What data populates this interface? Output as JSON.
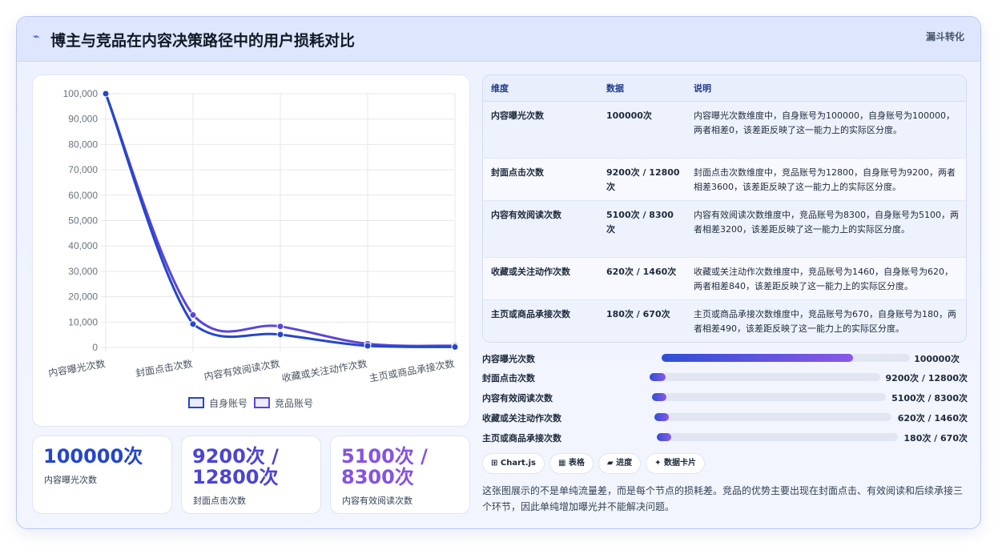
{
  "header": {
    "icon": "trend-icon",
    "title": "博主与竞品在内容决策路径中的用户损耗对比",
    "tag": "漏斗转化"
  },
  "chart_data": {
    "type": "line",
    "categories": [
      "内容曝光次数",
      "封面点击次数",
      "内容有效阅读次数",
      "收藏或关注动作次数",
      "主页或商品承接次数"
    ],
    "series": [
      {
        "name": "自身账号",
        "values": [
          100000,
          9200,
          5100,
          620,
          180
        ],
        "color": "#2446c9"
      },
      {
        "name": "竞品账号",
        "values": [
          100000,
          12800,
          8300,
          1460,
          670
        ],
        "color": "#5b45d6"
      }
    ],
    "ylim": [
      0,
      100000
    ],
    "yticks": [
      "0",
      "10,000",
      "20,000",
      "30,000",
      "40,000",
      "50,000",
      "60,000",
      "70,000",
      "80,000",
      "90,000",
      "100,000"
    ],
    "grid": true,
    "legend": "bottom"
  },
  "kpis": [
    {
      "value": "100000次",
      "label": "内容曝光次数",
      "color": "#2446c9"
    },
    {
      "value": "9200次 / 12800次",
      "label": "封面点击次数",
      "color": "#4a45d2"
    },
    {
      "value": "5100次 / 8300次",
      "label": "内容有效阅读次数",
      "color": "#8553e2"
    }
  ],
  "table": {
    "headers": [
      "维度",
      "数据",
      "说明"
    ],
    "rows": [
      {
        "dim": "内容曝光次数",
        "data": "100000次",
        "desc": "内容曝光次数维度中，自身账号为100000，自身账号为100000，两者相差0，该差距反映了这一能力上的实际区分度。"
      },
      {
        "dim": "封面点击次数",
        "data": "9200次 / 12800次",
        "desc": "封面点击次数维度中，竞品账号为12800，自身账号为9200，两者相差3600，该差距反映了这一能力上的实际区分度。"
      },
      {
        "dim": "内容有效阅读次数",
        "data": "5100次 / 8300次",
        "desc": "内容有效阅读次数维度中，竞品账号为8300，自身账号为5100，两者相差3200，该差距反映了这一能力上的实际区分度。"
      },
      {
        "dim": "收藏或关注动作次数",
        "data": "620次 / 1460次",
        "desc": "收藏或关注动作次数维度中，竞品账号为1460，自身账号为620，两者相差840，该差距反映了这一能力上的实际区分度。"
      },
      {
        "dim": "主页或商品承接次数",
        "data": "180次 / 670次",
        "desc": "主页或商品承接次数维度中，竞品账号为670，自身账号为180，两者相差490，该差距反映了这一能力上的实际区分度。"
      }
    ]
  },
  "progress": [
    {
      "label": "内容曝光次数",
      "value": "100000次",
      "fraction": 0.77
    },
    {
      "label": "封面点击次数",
      "value": "9200次 / 12800次",
      "fraction": 0.07
    },
    {
      "label": "内容有效阅读次数",
      "value": "5100次 / 8300次",
      "fraction": 0.06
    },
    {
      "label": "收藏或关注动作次数",
      "value": "620次 / 1460次",
      "fraction": 0.06
    },
    {
      "label": "主页或商品承接次数",
      "value": "180次 / 670次",
      "fraction": 0.06
    }
  ],
  "chips": [
    "⊞ Chart.js",
    "▦ 表格",
    "▰ 进度",
    "✦ 数据卡片"
  ],
  "note": "这张图展示的不是单纯流量差，而是每个节点的损耗差。竞品的优势主要出现在封面点击、有效阅读和后续承接三个环节，因此单纯增加曝光并不能解决问题。"
}
